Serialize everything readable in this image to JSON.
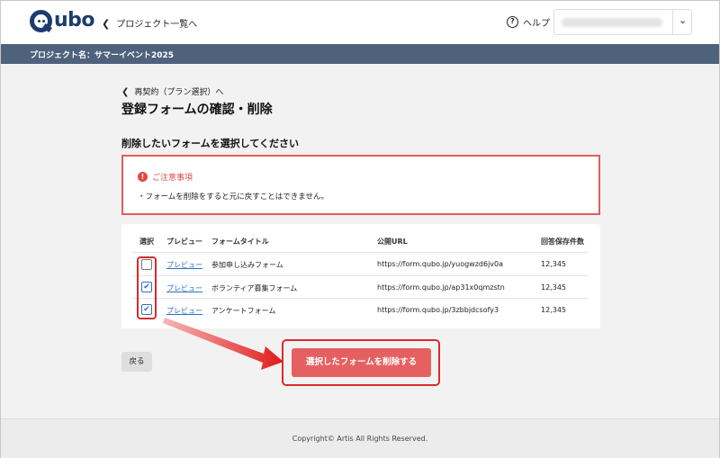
{
  "header": {
    "logo_text": "Qubo",
    "back_link": "プロジェクト一覧へ",
    "help_label": "ヘルプ"
  },
  "project_bar": {
    "label": "プロジェクト名：サマーイベント2025"
  },
  "breadcrumb": "再契約（プラン選択）へ",
  "page_title": "登録フォームの確認・削除",
  "section_title": "削除したいフォームを選択してください",
  "notice": {
    "title": "ご注意事項",
    "body": "・フォームを削除をすると元に戻すことはできません。"
  },
  "table": {
    "headers": {
      "select": "選択",
      "preview": "プレビュー",
      "title": "フォームタイトル",
      "url": "公開URL",
      "count": "回答保存件数"
    },
    "rows": [
      {
        "checked": false,
        "preview": "プレビュー",
        "title": "参加申し込みフォーム",
        "url": "https://form.qubo.jp/yuogwzd6jv0a",
        "count": "12,345"
      },
      {
        "checked": true,
        "preview": "プレビュー",
        "title": "ボランティア募集フォーム",
        "url": "https://form.qubo.jp/ap31x0qmzstn",
        "count": "12,345"
      },
      {
        "checked": true,
        "preview": "プレビュー",
        "title": "アンケートフォーム",
        "url": "https://form.qubo.jp/3zbbjdcsofy3",
        "count": "12,345"
      }
    ]
  },
  "buttons": {
    "back": "戻る",
    "delete": "選択したフォームを削除する"
  },
  "footer": "Copyright© Artis All Rights Reserved.",
  "colors": {
    "brand": "#1d3d6e",
    "project_bar": "#4e627c",
    "danger": "#e56161",
    "highlight": "#d92b2b",
    "link": "#2b6fc4"
  }
}
